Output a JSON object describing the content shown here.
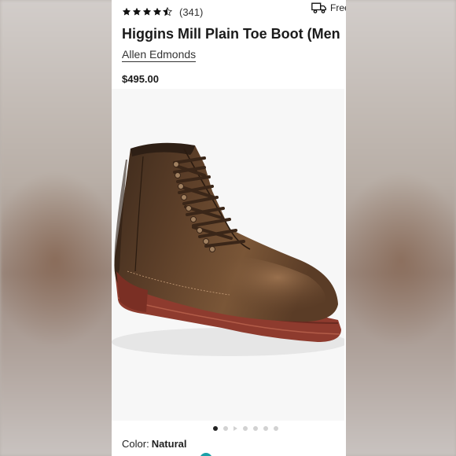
{
  "product": {
    "rating_stars": 4.5,
    "review_count": "(341)",
    "shipping_label": "Free",
    "title": "Higgins Mill Plain Toe Boot (Men",
    "brand": "Allen Edmonds",
    "price": "$495.00"
  },
  "gallery": {
    "image_count": 7,
    "active_index": 0
  },
  "color": {
    "label": "Color:",
    "value": "Natural"
  },
  "icons": {
    "rating": "star-icon",
    "shipping": "truck-icon"
  },
  "colors": {
    "boot_leather": "#6b4a30",
    "sole": "#8e3b2e",
    "text": "#1a1a1a"
  }
}
